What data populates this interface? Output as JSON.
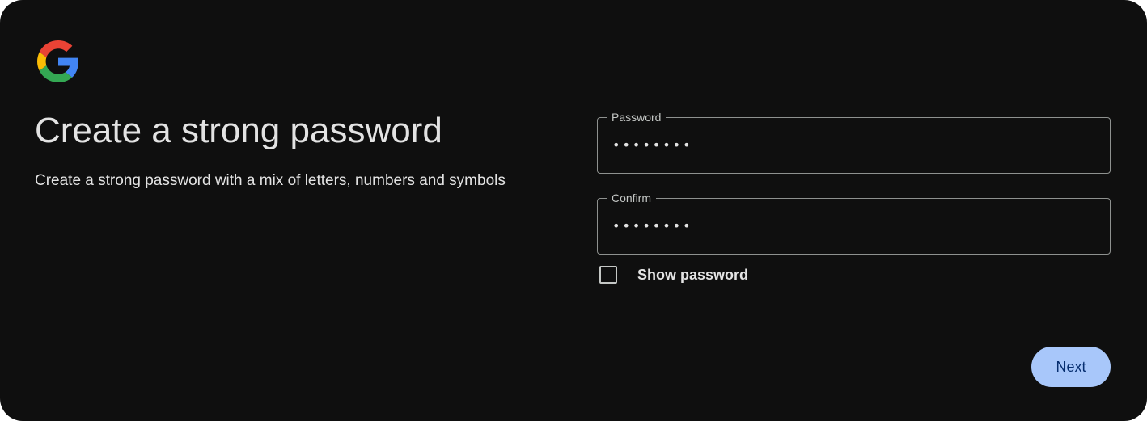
{
  "header": {
    "logo_icon": "google-g-logo",
    "colors": {
      "blue": "#4285F4",
      "red": "#EA4335",
      "yellow": "#FBBC05",
      "green": "#34A853"
    }
  },
  "main": {
    "title": "Create a strong password",
    "subtitle": "Create a strong password with a mix of letters, numbers and symbols"
  },
  "form": {
    "password": {
      "label": "Password",
      "value": "••••••••"
    },
    "confirm": {
      "label": "Confirm",
      "value": "••••••••"
    },
    "show_password": {
      "label": "Show password",
      "checked": false
    }
  },
  "actions": {
    "next_label": "Next",
    "next_color": "#a8c7fa"
  },
  "theme": {
    "background": "#0f0f0f",
    "text": "#e3e3e3"
  }
}
